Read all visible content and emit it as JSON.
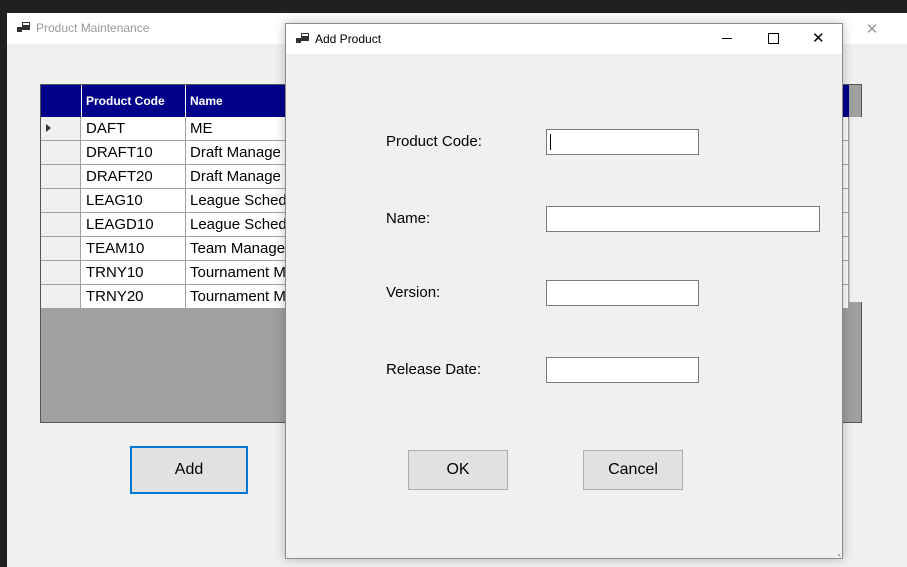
{
  "main_window": {
    "title": "Product Maintenance",
    "close_glyph": "✕",
    "icon": "app-window-icon"
  },
  "grid": {
    "columns": [
      {
        "label": "Product Code"
      },
      {
        "label": "Name"
      }
    ],
    "rows": [
      {
        "code": "DAFT",
        "name": "ME",
        "selected": true
      },
      {
        "code": "DRAFT10",
        "name": "Draft Manage"
      },
      {
        "code": "DRAFT20",
        "name": "Draft Manage"
      },
      {
        "code": "LEAG10",
        "name": "League Sched"
      },
      {
        "code": "LEAGD10",
        "name": "League Sched"
      },
      {
        "code": "TEAM10",
        "name": "Team Manage"
      },
      {
        "code": "TRNY10",
        "name": "Tournament M"
      },
      {
        "code": "TRNY20",
        "name": "Tournament M"
      }
    ],
    "header_color": "#00008b"
  },
  "main_buttons": {
    "add_label": "Add"
  },
  "dialog": {
    "title": "Add Product",
    "icon": "app-window-icon",
    "controls": {
      "minimize": "minimize-icon",
      "maximize": "maximize-icon",
      "close": "close-icon",
      "close_glyph": "✕"
    },
    "fields": {
      "product_code": {
        "label": "Product Code:",
        "value": ""
      },
      "name": {
        "label": "Name:",
        "value": ""
      },
      "version": {
        "label": "Version:",
        "value": ""
      },
      "release_date": {
        "label": "Release Date:",
        "value": ""
      }
    },
    "ok_label": "OK",
    "cancel_label": "Cancel"
  },
  "colors": {
    "accent_focus": "#0078d7",
    "window_bg": "#f0f0f0"
  }
}
